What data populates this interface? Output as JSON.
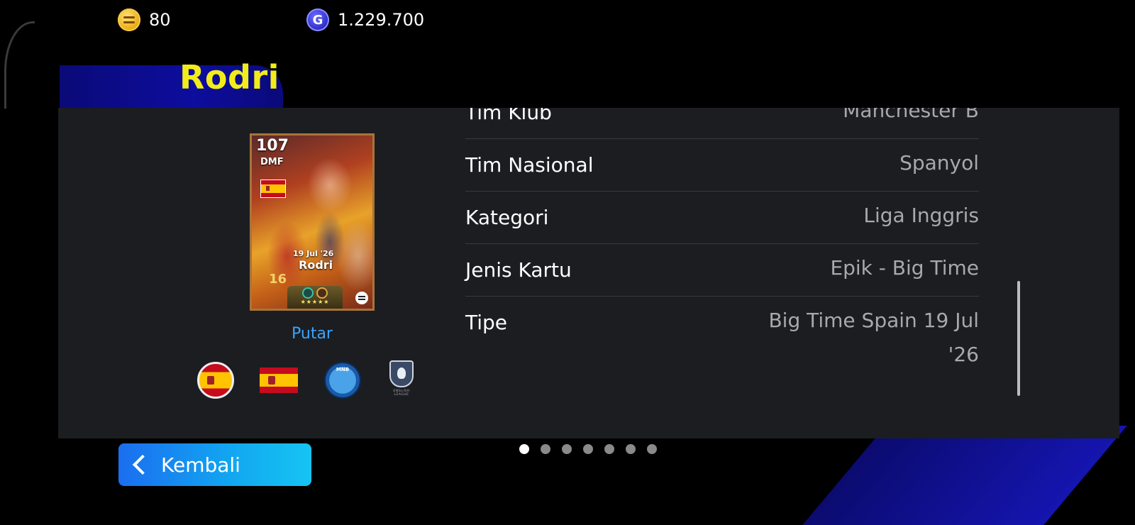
{
  "currency": {
    "coins": {
      "icon": "efootball-coin-icon",
      "value": "80"
    },
    "gp": {
      "icon": "gp-icon",
      "value": "1.229.700"
    }
  },
  "player": {
    "name": "Rodri",
    "card": {
      "rating": "107",
      "position": "DMF",
      "date": "19 Jul '26",
      "name": "Rodri",
      "shirt_number": "16",
      "stars": "★★★★★"
    },
    "play_label": "Putar"
  },
  "info_rows": [
    {
      "label": "Tim Klub",
      "value": "Manchester B"
    },
    {
      "label": "Tim Nasional",
      "value": "Spanyol"
    },
    {
      "label": "Kategori",
      "value": "Liga Inggris"
    },
    {
      "label": "Jenis Kartu",
      "value": "Epik - Big Time"
    },
    {
      "label": "Tipe",
      "value": "Big Time Spain 19 Jul '26"
    }
  ],
  "badges": {
    "club_text": "MNB",
    "league_text": "ENGLISH LEAGUE"
  },
  "pagination": {
    "total": 7,
    "active": 1
  },
  "back_button": {
    "label": "Kembali"
  },
  "colors": {
    "accent_blue": "#16a2f0",
    "title_yellow": "#f2ec1a",
    "panel": "#1c1d21"
  }
}
